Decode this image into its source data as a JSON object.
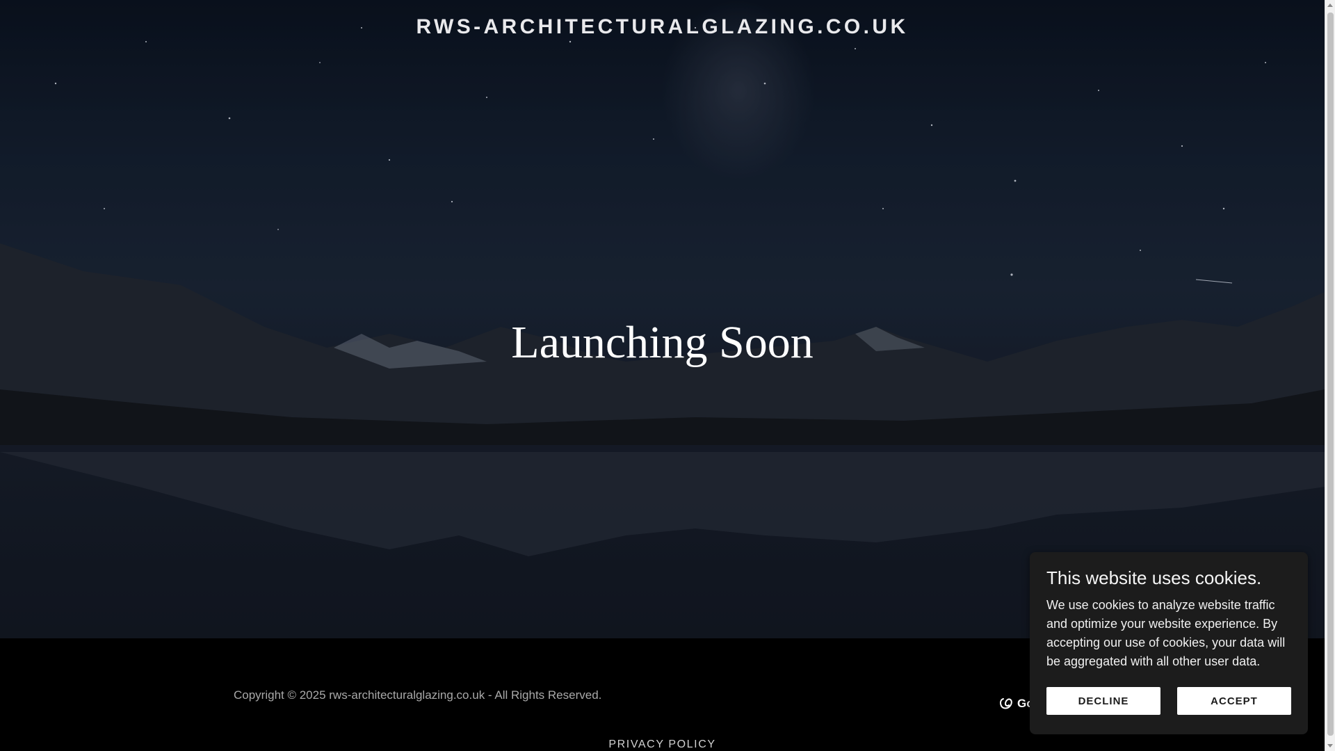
{
  "header": {
    "site_title": "RWS-ARCHITECTURALGLAZING.CO.UK"
  },
  "hero": {
    "headline": "Launching Soon",
    "background": "night-sky-mountain-lake-image"
  },
  "footer": {
    "copyright": "Copyright © 2025 rws-architecturalglazing.co.uk - All Rights Reserved.",
    "privacy_policy": "PRIVACY POLICY",
    "brand_logo_text": "Go",
    "brand_icon": "godaddy-logo-icon"
  },
  "cookie_banner": {
    "title": "This website uses cookies.",
    "body": "We use cookies to analyze website traffic and optimize your website experience. By accepting our use of cookies, your data will be aggregated with all other user data.",
    "decline_label": "DECLINE",
    "accept_label": "ACCEPT"
  },
  "colors": {
    "footer_bg": "#000000",
    "cookie_bg": "#1c1c1c",
    "button_bg": "#ffffff",
    "button_text": "#1b1b1b"
  }
}
